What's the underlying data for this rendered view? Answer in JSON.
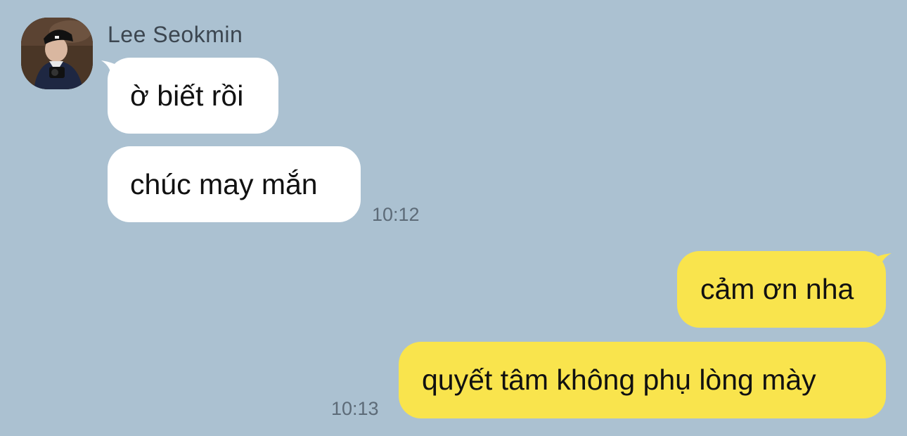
{
  "colors": {
    "background": "#abc1d1",
    "incoming_bubble": "#ffffff",
    "outgoing_bubble": "#f9e44d",
    "timestamp": "#5d6b78",
    "sender_name": "#3c4650"
  },
  "contact": {
    "name": "Lee Seokmin",
    "avatar_icon": "profile-photo"
  },
  "messages": [
    {
      "direction": "incoming",
      "text": "ờ biết rồi"
    },
    {
      "direction": "incoming",
      "text": "chúc may mắn",
      "time": "10:12"
    },
    {
      "direction": "outgoing",
      "text": "cảm ơn nha"
    },
    {
      "direction": "outgoing",
      "text": "quyết tâm không phụ lòng mày",
      "time": "10:13"
    }
  ]
}
